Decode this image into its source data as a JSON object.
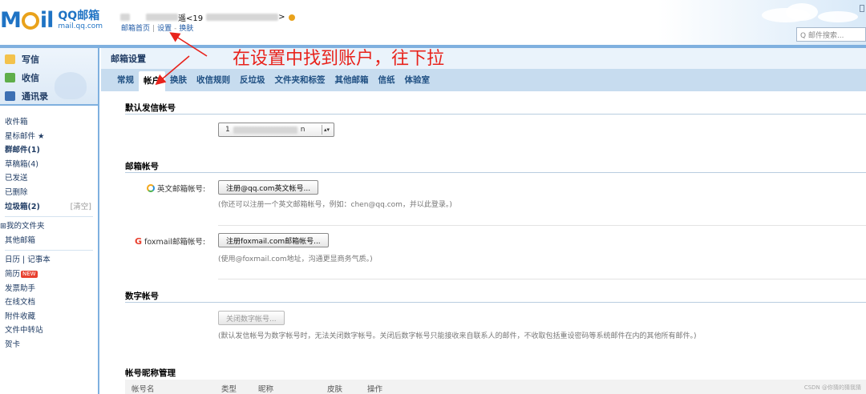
{
  "header": {
    "logo_mail": "Mail",
    "logo_qq": "QQ邮箱",
    "logo_domain": "mail.qq.com",
    "user_name_suffix": "遥<19",
    "user_email_end": ">",
    "links": [
      "邮箱首页",
      "设置",
      "换肤"
    ],
    "search_placeholder": "Q 邮件搜索..."
  },
  "sidebar": {
    "actions": [
      "写信",
      "收信",
      "通讯录"
    ],
    "folders": [
      {
        "label": "收件箱"
      },
      {
        "label": "星标邮件 ★"
      },
      {
        "label": "群邮件(1)",
        "bold": true
      },
      {
        "label": "草稿箱(4)"
      },
      {
        "label": "已发送"
      },
      {
        "label": "已删除"
      },
      {
        "label": "垃圾箱(2)",
        "bold": true,
        "extra": "[清空]"
      }
    ],
    "my_folders": "⊞我的文件夹",
    "other_mail": "其他邮箱",
    "tools_first": "日历 | 记事本",
    "tools": [
      {
        "label": "简历",
        "badge": "NEW"
      },
      {
        "label": "发票助手"
      },
      {
        "label": "在线文档"
      },
      {
        "label": "附件收藏"
      },
      {
        "label": "文件中转站"
      },
      {
        "label": "贺卡"
      }
    ]
  },
  "main": {
    "title": "邮箱设置",
    "tabs": [
      "常规",
      "帐户",
      "换肤",
      "收信规则",
      "反垃圾",
      "文件夹和标签",
      "其他邮箱",
      "信纸",
      "体验室"
    ],
    "active_tab": "帐户",
    "default_sender": {
      "title": "默认发信帐号",
      "select_value_prefix": "1",
      "select_value_suffix": "n"
    },
    "mailbox_accounts": {
      "title": "邮箱帐号",
      "english_label": "英文邮箱帐号:",
      "english_button": "注册@qq.com英文帐号...",
      "english_hint": "(你还可以注册一个英文邮箱帐号，例如：chen@qq.com，并以此登录。)",
      "foxmail_label": "foxmail邮箱帐号:",
      "foxmail_button": "注册foxmail.com邮箱帐号...",
      "foxmail_hint": "(使用@foxmail.com地址，沟通更显商务气质。)"
    },
    "digital_account": {
      "title": "数字帐号",
      "button": "关闭数字帐号...",
      "hint": "(默认发信帐号为数字帐号时，无法关闭数字帐号。关闭后数字帐号只能接收来自联系人的邮件，不收取包括重设密码等系统邮件在内的其他所有邮件。)"
    },
    "nickname": {
      "title": "帐号昵称管理",
      "columns": [
        "帐号名",
        "类型",
        "昵称",
        "皮肤",
        "操作"
      ]
    }
  },
  "annotation": {
    "text": "在设置中找到账户，往下拉",
    "color": "#e8231c"
  },
  "watermark": "CSDN @你猜的猜我猜"
}
